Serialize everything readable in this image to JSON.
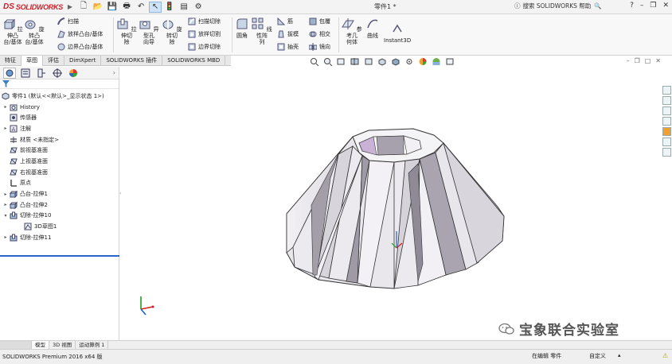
{
  "app": {
    "brand_prefix": "DS",
    "brand_name": "SOLIDWORKS",
    "doc_title": "零件1 *",
    "search_label": "搜索 SOLIDWORKS 帮助"
  },
  "ribbon": {
    "extrude_boss": "拉伸凸\n台/基体",
    "revolve_boss": "旋转凸\n台/基体",
    "sweep": "扫描",
    "loft_boss": "放样凸台/基体",
    "boundary_boss": "边界凸台/基体",
    "extrude_cut": "拉伸切\n除",
    "hole_wizard": "异型孔\n向导",
    "revolve_cut": "旋转切\n除",
    "sweep_cut": "扫描切除",
    "loft_cut": "放样切割",
    "boundary_cut": "边界切除",
    "fillet": "圆角",
    "linear_pattern": "线性阵\n列",
    "rib": "筋",
    "draft": "拔模",
    "shell": "抽壳",
    "wrap": "包覆",
    "intersect": "相交",
    "mirror": "镜向",
    "ref_geometry": "参考几\n何体",
    "curves": "曲线",
    "instant3d": "Instant3D"
  },
  "tabs": [
    "特征",
    "草图",
    "评估",
    "DimXpert",
    "SOLIDWORKS 插件",
    "SOLIDWORKS MBD"
  ],
  "tree": {
    "root": "零件1 (默认<<默认>_显示状态 1>)",
    "items": [
      {
        "label": "History",
        "exp": "▸"
      },
      {
        "label": "传感器",
        "exp": ""
      },
      {
        "label": "注解",
        "exp": "▸"
      },
      {
        "label": "材质 <未指定>",
        "exp": ""
      },
      {
        "label": "前视基准面",
        "exp": ""
      },
      {
        "label": "上视基准面",
        "exp": ""
      },
      {
        "label": "右视基准面",
        "exp": ""
      },
      {
        "label": "原点",
        "exp": ""
      },
      {
        "label": "凸台-拉伸1",
        "exp": "▸"
      },
      {
        "label": "凸台-拉伸2",
        "exp": "▸"
      },
      {
        "label": "切除-拉伸10",
        "exp": "▾"
      },
      {
        "label": "3D草图1",
        "exp": ""
      },
      {
        "label": "切除-拉伸11",
        "exp": "▸"
      }
    ]
  },
  "bottom_tabs": [
    "模型",
    "3D 视图",
    "运动算例 1"
  ],
  "status": {
    "product": "SOLIDWORKS Premium 2016 x64 版",
    "editing": "在编辑 零件",
    "custom": "自定义"
  },
  "watermark": "宝象联合实验室",
  "colors": {
    "accent": "#d0202a",
    "selection_blue": "#2a66c9",
    "part_face": "#e6e3ea",
    "part_shadow": "#a8a3ae",
    "part_highlight": "#c9b2d6"
  }
}
